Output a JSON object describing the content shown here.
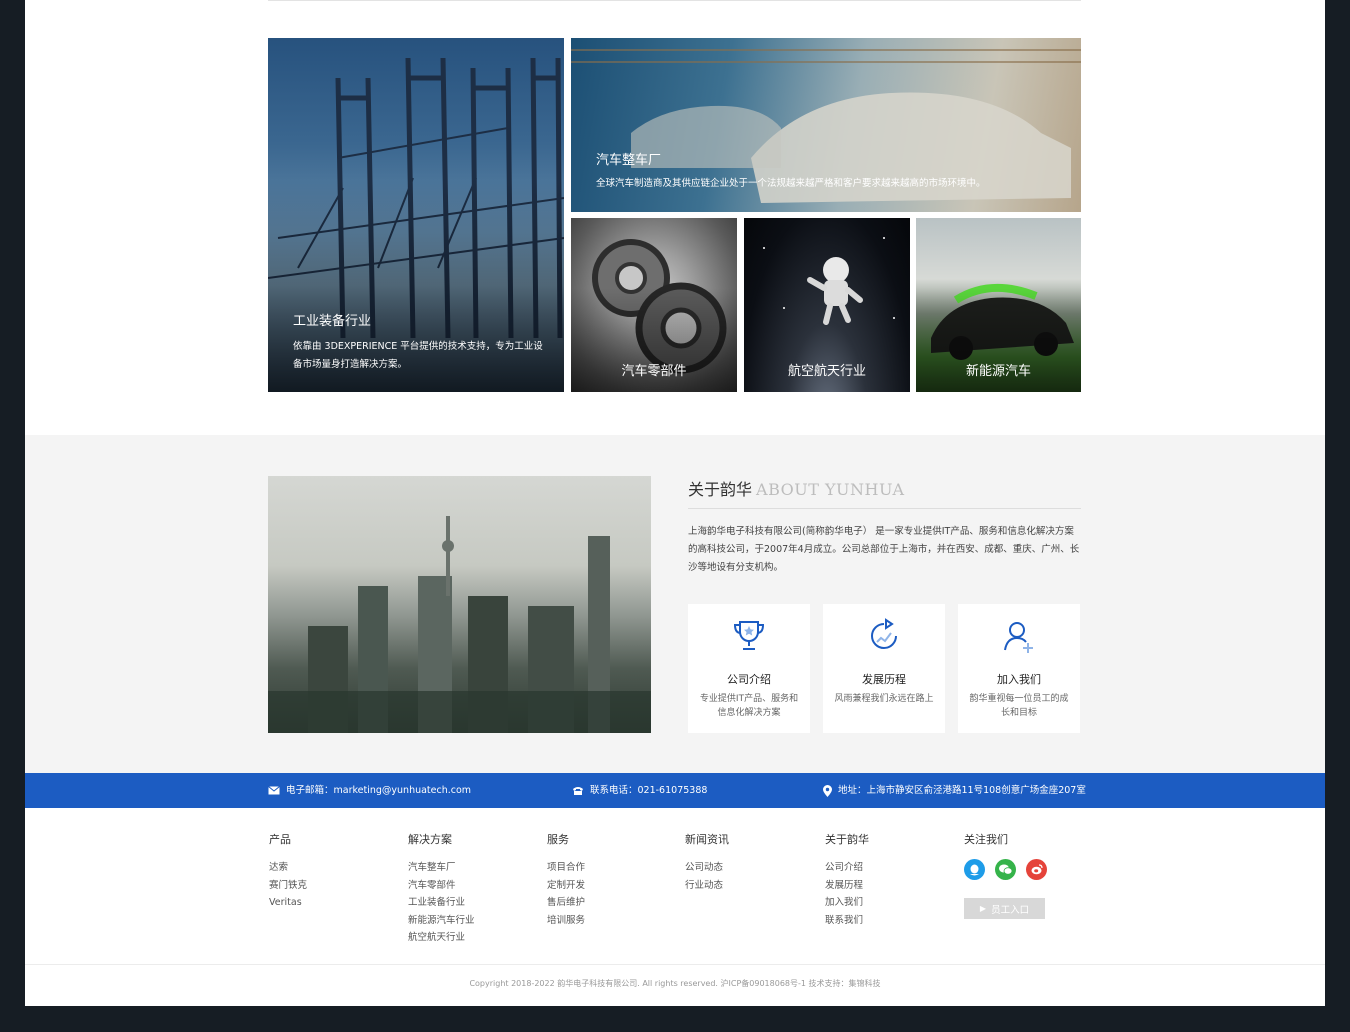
{
  "industries": {
    "industrial": {
      "title": "工业装备行业",
      "desc": "依靠由 3DEXPERIENCE 平台提供的技术支持，专为工业设备市场量身打造解决方案。"
    },
    "auto": {
      "title": "汽车整车厂",
      "desc": "全球汽车制造商及其供应链企业处于一个法规越来越严格和客户要求越来越高的市场环境中。"
    },
    "parts": {
      "title": "汽车零部件"
    },
    "aero": {
      "title": "航空航天行业"
    },
    "ev": {
      "title": "新能源汽车"
    }
  },
  "about": {
    "title_cn": "关于韵华",
    "title_en": "ABOUT YUNHUA",
    "text": "上海韵华电子科技有限公司(简称韵华电子） 是一家专业提供IT产品、服务和信息化解决方案的高科技公司，于2007年4月成立。公司总部位于上海市，并在西安、成都、重庆、广州、长沙等地设有分支机构。",
    "cards": [
      {
        "title": "公司介绍",
        "desc": "专业提供IT产品、服务和信息化解决方案",
        "icon": "trophy-icon"
      },
      {
        "title": "发展历程",
        "desc": "风雨兼程我们永远在路上",
        "icon": "history-icon"
      },
      {
        "title": "加入我们",
        "desc": "韵华重视每一位员工的成长和目标",
        "icon": "join-icon"
      }
    ]
  },
  "contact": {
    "email": "电子邮箱：marketing@yunhuatech.com",
    "phone": "联系电话：021-61075388",
    "address": "地址：上海市静安区俞泾港路11号108创意广场金座207室"
  },
  "footer": {
    "columns": [
      {
        "heading": "产品",
        "links": [
          "达索",
          "赛门铁克",
          "Veritas"
        ]
      },
      {
        "heading": "解决方案",
        "links": [
          "汽车整车厂",
          "汽车零部件",
          "工业装备行业",
          "新能源汽车行业",
          "航空航天行业"
        ]
      },
      {
        "heading": "服务",
        "links": [
          "项目合作",
          "定制开发",
          "售后维护",
          "培训服务"
        ]
      },
      {
        "heading": "新闻资讯",
        "links": [
          "公司动态",
          "行业动态"
        ]
      },
      {
        "heading": "关于韵华",
        "links": [
          "公司介绍",
          "发展历程",
          "加入我们",
          "联系我们"
        ]
      }
    ],
    "follow_heading": "关注我们",
    "staff_entry": "员工入口",
    "copyright": "Copyright 2018-2022 韵华电子科技有限公司. All rights reserved. 沪ICP备09018068号-1   技术支持：集锦科技"
  },
  "colors": {
    "brand_blue": "#1c5cc2",
    "qq": "#1e9ce8",
    "wechat": "#35b34a",
    "weibo": "#e5433a"
  }
}
